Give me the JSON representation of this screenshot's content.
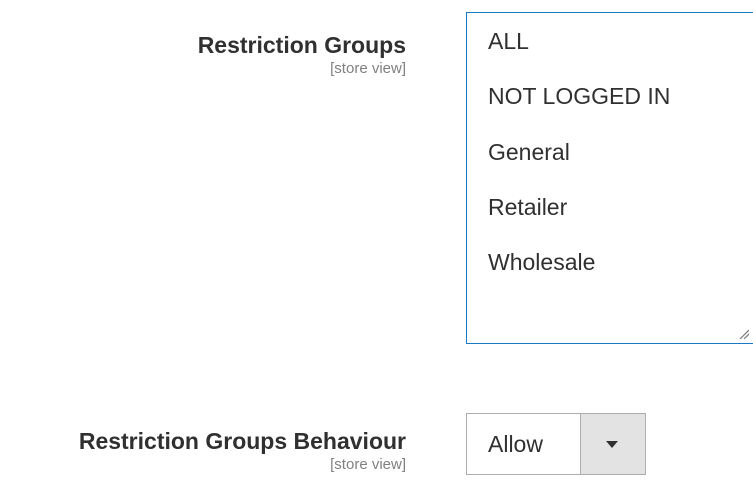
{
  "restriction_groups": {
    "label": "Restriction Groups",
    "scope": "[store view]",
    "options": [
      "ALL",
      "NOT LOGGED IN",
      "General",
      "Retailer",
      "Wholesale"
    ]
  },
  "restriction_groups_behaviour": {
    "label": "Restriction Groups Behaviour",
    "scope": "[store view]",
    "selected": "Allow"
  },
  "colors": {
    "focus_border": "#1979c3",
    "arrow_bg": "#e3e3e3"
  }
}
